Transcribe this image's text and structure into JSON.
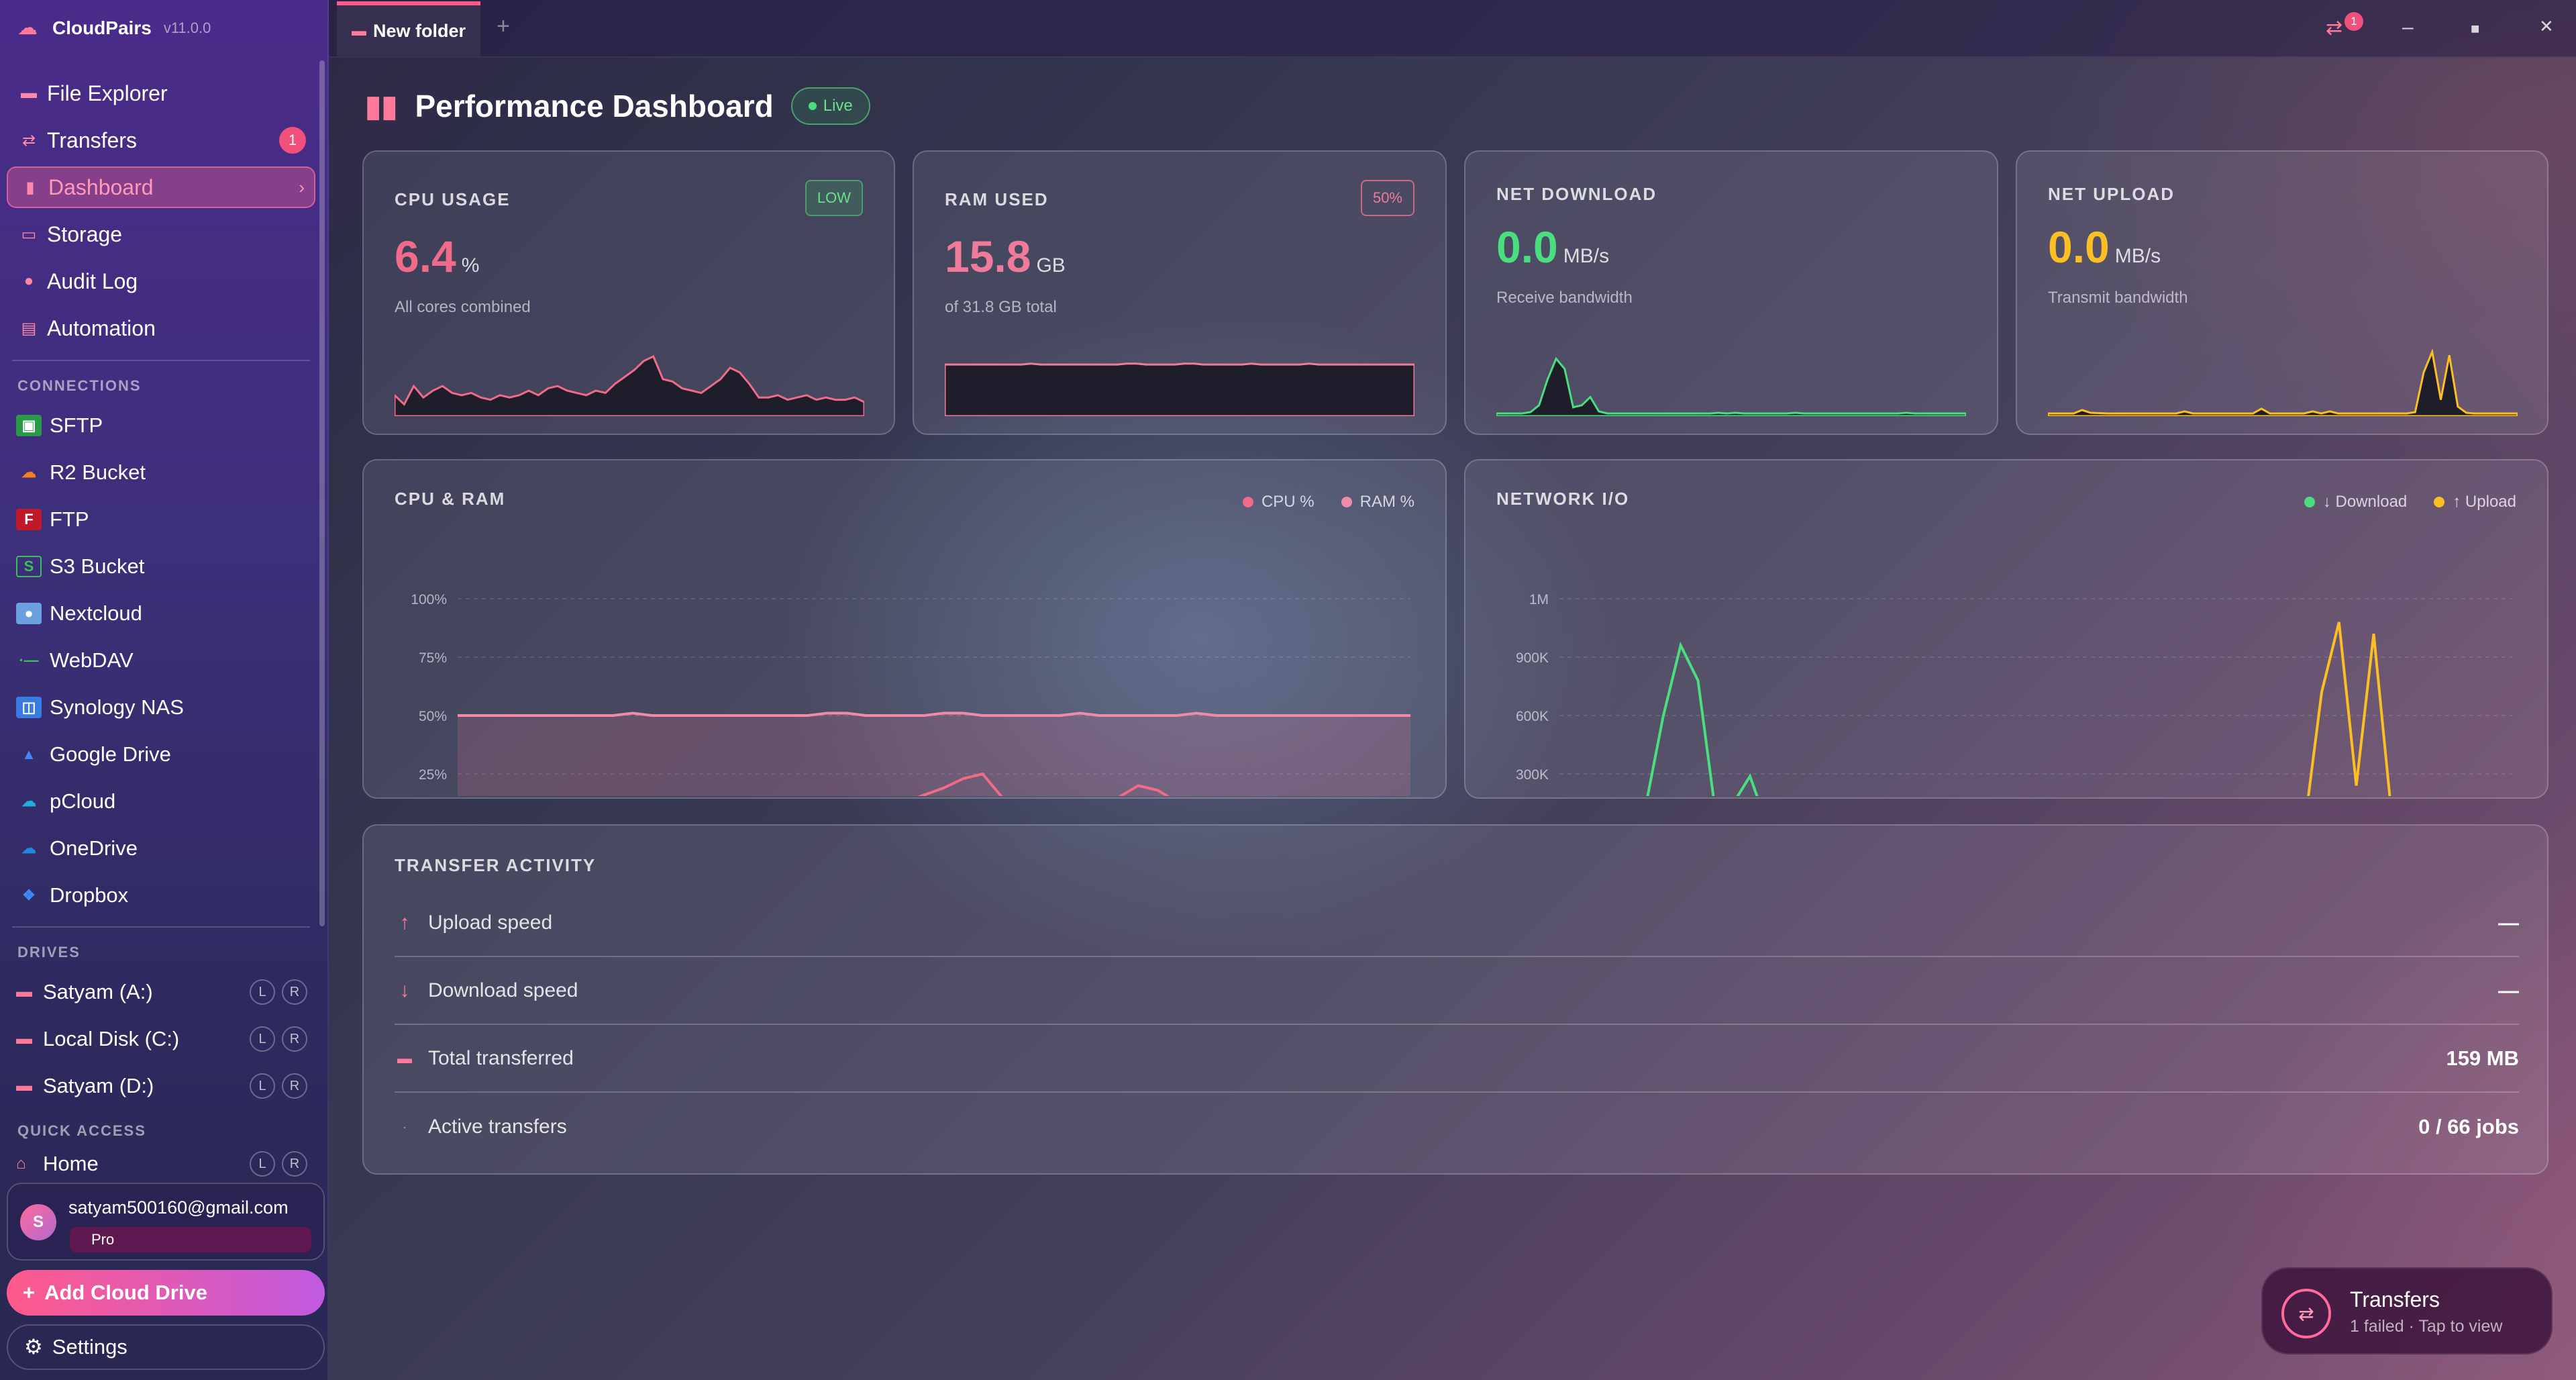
{
  "app": {
    "name": "CloudPairs",
    "version": "v11.0.0"
  },
  "nav": [
    {
      "label": "File Explorer",
      "icon": "folder-icon"
    },
    {
      "label": "Transfers",
      "icon": "transfer-icon",
      "badge": "1"
    },
    {
      "label": "Dashboard",
      "icon": "bar-chart-icon",
      "active": true
    },
    {
      "label": "Storage",
      "icon": "storage-icon"
    },
    {
      "label": "Audit Log",
      "icon": "clock-icon"
    },
    {
      "label": "Automation",
      "icon": "automation-icon"
    }
  ],
  "sections": {
    "connections": "CONNECTIONS",
    "drives": "DRIVES",
    "quick_access": "QUICK ACCESS"
  },
  "connections": [
    {
      "label": "SFTP",
      "icon": "sftp-icon",
      "color": "#3bbf5a"
    },
    {
      "label": "R2 Bucket",
      "icon": "cloudflare-icon",
      "color": "#f38020"
    },
    {
      "label": "FTP",
      "icon": "ftp-icon",
      "color": "#d02030"
    },
    {
      "label": "S3 Bucket",
      "icon": "s3-bucket-icon",
      "color": "#3bbf5a"
    },
    {
      "label": "Nextcloud",
      "icon": "nextcloud-icon",
      "color": "#4a90e2"
    },
    {
      "label": "WebDAV",
      "icon": "webdav-icon",
      "color": "#3bbf5a"
    },
    {
      "label": "Synology NAS",
      "icon": "synology-icon",
      "color": "#3a7be0"
    },
    {
      "label": "Google Drive",
      "icon": "google-drive-icon",
      "color": "#4285f4"
    },
    {
      "label": "pCloud",
      "icon": "pcloud-icon",
      "color": "#20b0e0"
    },
    {
      "label": "OneDrive",
      "icon": "onedrive-icon",
      "color": "#1c8ae0"
    },
    {
      "label": "Dropbox",
      "icon": "dropbox-icon",
      "color": "#3d8af7"
    }
  ],
  "drives": [
    {
      "label": "Satyam (A:)",
      "l": "L",
      "r": "R"
    },
    {
      "label": "Local Disk (C:)",
      "l": "L",
      "r": "R"
    },
    {
      "label": "Satyam (D:)",
      "l": "L",
      "r": "R"
    }
  ],
  "quick_access": [
    {
      "label": "Home",
      "l": "L",
      "r": "R"
    }
  ],
  "user": {
    "initial": "S",
    "email": "satyam500160@gmail.com",
    "plan": "Pro"
  },
  "add_cloud_label": "Add Cloud Drive",
  "settings_label": "Settings",
  "tab": {
    "label": "New folder",
    "new_tab": "+",
    "notif_badge": "1"
  },
  "window": {
    "minimize": "–",
    "maximize": "■",
    "close": "✕"
  },
  "page": {
    "title": "Performance Dashboard",
    "live": "Live"
  },
  "stats": {
    "cpu": {
      "label": "CPU USAGE",
      "value": "6.4",
      "unit": "%",
      "sub": "All cores combined",
      "pill": "LOW",
      "color": "#f06a8a"
    },
    "ram": {
      "label": "RAM USED",
      "value": "15.8",
      "unit": "GB",
      "sub": "of 31.8 GB total",
      "pill": "50%",
      "color": "#f07a9a"
    },
    "down": {
      "label": "NET DOWNLOAD",
      "value": "0.0",
      "unit": "MB/s",
      "sub": "Receive bandwidth",
      "color": "#4ade80"
    },
    "up": {
      "label": "NET UPLOAD",
      "value": "0.0",
      "unit": "MB/s",
      "sub": "Transmit bandwidth",
      "color": "#fbbf24"
    }
  },
  "cpu_ram_chart": {
    "title": "CPU & RAM",
    "legend_cpu": "CPU %",
    "legend_ram": "RAM %",
    "y_ticks": [
      "100%",
      "75%",
      "50%",
      "25%"
    ]
  },
  "network_chart": {
    "title": "NETWORK I/O",
    "legend_down": "↓ Download",
    "legend_up": "↑ Upload",
    "y_ticks": [
      "1M",
      "900K",
      "600K",
      "300K"
    ]
  },
  "chart_data": [
    {
      "type": "line",
      "title": "CPU & RAM",
      "ylim": [
        0,
        100
      ],
      "series": [
        {
          "name": "CPU %",
          "values": [
            8,
            4,
            12,
            7,
            10,
            12,
            9,
            8,
            9,
            7,
            6,
            8,
            7,
            8,
            10,
            8,
            11,
            12,
            10,
            9,
            8,
            10,
            9,
            13,
            16,
            19,
            23,
            25,
            15,
            14,
            11,
            10,
            9,
            12,
            15,
            20,
            18,
            13,
            7,
            7,
            8,
            6,
            7,
            8,
            6,
            7,
            6,
            6,
            7,
            5
          ]
        },
        {
          "name": "RAM %",
          "values": [
            50,
            50,
            50,
            50,
            50,
            50,
            50,
            50,
            50,
            51,
            50,
            50,
            50,
            50,
            50,
            50,
            50,
            50,
            50,
            51,
            51,
            50,
            50,
            50,
            50,
            51,
            51,
            50,
            50,
            50,
            50,
            50,
            51,
            50,
            50,
            50,
            50,
            50,
            51,
            50,
            50,
            50,
            50,
            50,
            50,
            50,
            50,
            50,
            50,
            50
          ]
        }
      ]
    },
    {
      "type": "line",
      "title": "NETWORK I/O",
      "ylim": [
        0,
        1000000
      ],
      "series": [
        {
          "name": "↓ Download",
          "values": [
            0,
            0,
            0,
            0,
            20000,
            120000,
            500000,
            800000,
            650000,
            90000,
            120000,
            240000,
            30000,
            0,
            0,
            0,
            0,
            0,
            0,
            0,
            0,
            0,
            0,
            0,
            0,
            0,
            10000,
            0,
            10000,
            0,
            0,
            0,
            0,
            0,
            0,
            10000,
            0,
            0,
            0,
            0,
            0,
            0,
            0,
            0,
            0,
            0,
            0,
            0,
            10000,
            0,
            0,
            0,
            0,
            0,
            0,
            0
          ]
        },
        {
          "name": "↑ Upload",
          "values": [
            0,
            0,
            0,
            0,
            50000,
            10000,
            5000,
            0,
            0,
            0,
            0,
            0,
            0,
            0,
            0,
            0,
            30000,
            0,
            0,
            0,
            0,
            0,
            0,
            0,
            0,
            70000,
            0,
            0,
            0,
            0,
            0,
            30000,
            0,
            30000,
            0,
            0,
            0,
            0,
            0,
            0,
            0,
            0,
            0,
            20000,
            600000,
            900000,
            200000,
            850000,
            100000,
            10000,
            0,
            0,
            0,
            0,
            0,
            0
          ]
        }
      ]
    }
  ],
  "transfer_activity": {
    "title": "TRANSFER ACTIVITY",
    "rows": [
      {
        "label": "Upload speed",
        "value": "—",
        "icon": "arrow-up-icon"
      },
      {
        "label": "Download speed",
        "value": "—",
        "icon": "arrow-down-icon"
      },
      {
        "label": "Total transferred",
        "value": "159 MB",
        "icon": "drive-icon"
      },
      {
        "label": "Active transfers",
        "value": "0 / 66 jobs",
        "icon": "dot-icon"
      }
    ]
  },
  "toast": {
    "title": "Transfers",
    "sub": "1 failed · Tap to view"
  }
}
